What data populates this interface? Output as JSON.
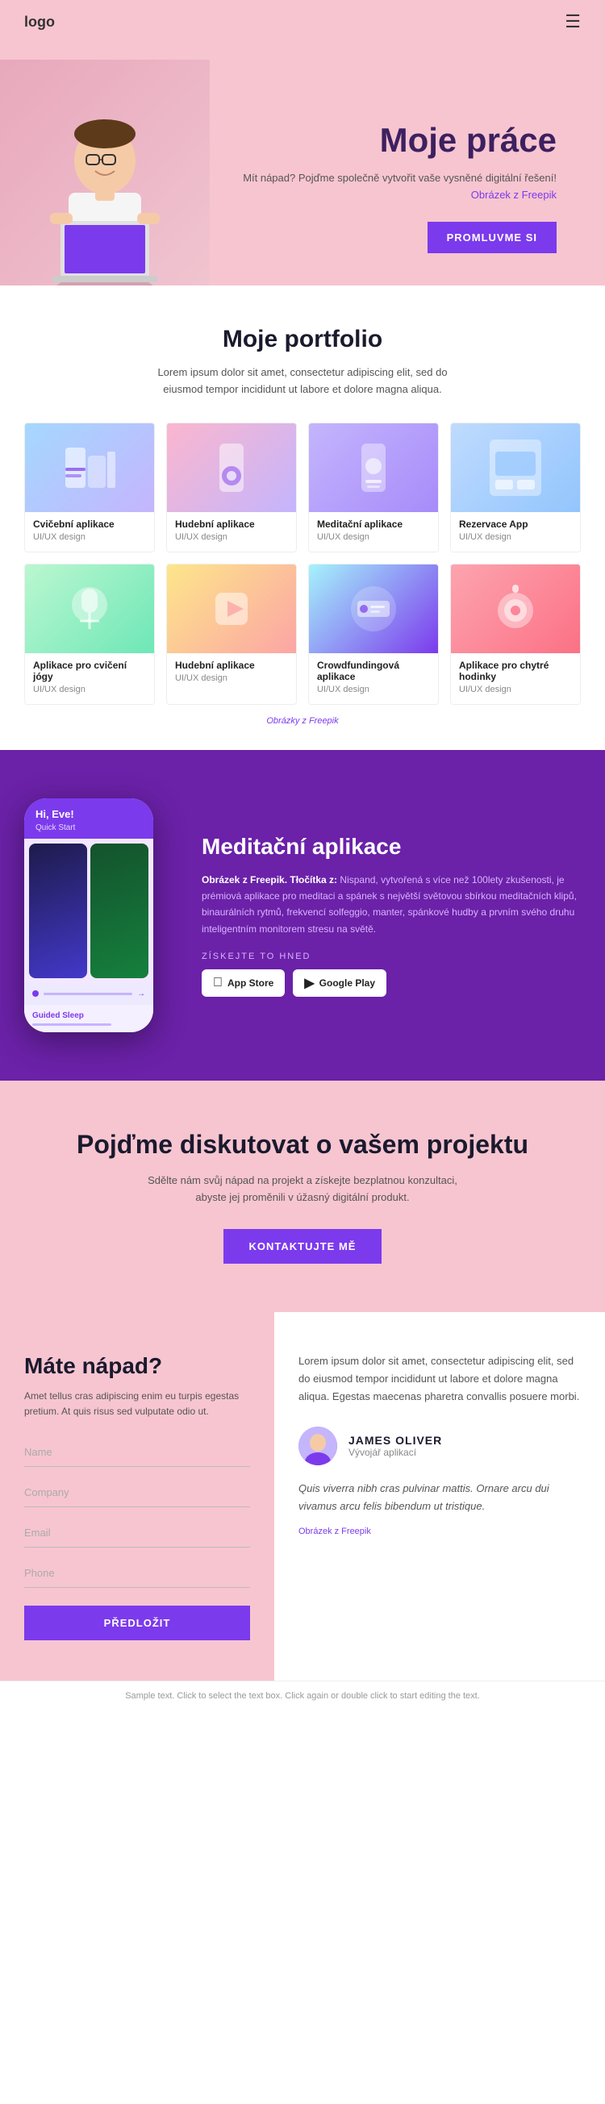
{
  "header": {
    "logo": "logo",
    "hamburger": "☰"
  },
  "hero": {
    "title": "Moje práce",
    "description": "Mít nápad? Pojďme společně vytvořit vaše vysněné digitální řešení!",
    "image_credit": "Obrázek z Freepik",
    "button_label": "PROMLUVME SI"
  },
  "portfolio": {
    "title": "Moje portfolio",
    "description": "Lorem ipsum dolor sit amet, consectetur adipiscing elit, sed do eiusmod tempor incididunt ut labore et dolore magna aliqua.",
    "images_credit": "Obrázky z Freepik",
    "cards": [
      {
        "name": "Cvičební aplikace",
        "type": "UI/UX design",
        "bg": "app1"
      },
      {
        "name": "Hudební aplikace",
        "type": "UI/UX design",
        "bg": "app2"
      },
      {
        "name": "Meditační aplikace",
        "type": "UI/UX design",
        "bg": "app3"
      },
      {
        "name": "Rezervace App",
        "type": "UI/UX design",
        "bg": "app4"
      },
      {
        "name": "Aplikace pro cvičení jógy",
        "type": "UI/UX design",
        "bg": "app5"
      },
      {
        "name": "Hudební aplikace",
        "type": "UI/UX design",
        "bg": "app6"
      },
      {
        "name": "Crowdfundingová aplikace",
        "type": "UI/UX design",
        "bg": "app7"
      },
      {
        "name": "Aplikace pro chytré hodinky",
        "type": "UI/UX design",
        "bg": "app8"
      }
    ]
  },
  "meditation": {
    "phone_greeting": "Hi, Eve!",
    "title": "Meditační aplikace",
    "description_bold": "Obrázek z Freepik. Tłočítka z:",
    "description": "Nispand, vytvořená s více než 100lety zkušenosti, je prémiová aplikace pro meditaci a spánek s největší světovou sbírkou meditačních klipů, binaurálních rytmů, frekvencí solfeggio, manter, spánkové hudby a prvním svého druhu inteligentním monitorem stresu na světě.",
    "get_now_label": "ZÍSKEJTE TO HNED",
    "appstore_label": "App Store",
    "googleplay_label": "Google Play"
  },
  "discuss": {
    "title": "Pojďme diskutovat o vašem projektu",
    "description": "Sdělte nám svůj nápad na projekt a získejte bezplatnou konzultaci, abyste jej proměnili v úžasný digitální produkt.",
    "button_label": "KONTAKTUJTE MĚ"
  },
  "contact": {
    "form": {
      "title": "Máte nápad?",
      "description": "Amet tellus cras adipiscing enim eu turpis egestas pretium. At quis risus sed vulputate odio ut.",
      "name_placeholder": "Name",
      "company_placeholder": "Company",
      "email_placeholder": "Email",
      "phone_placeholder": "Phone",
      "submit_label": "PŘEDLOŽIT"
    },
    "info": {
      "text": "Lorem ipsum dolor sit amet, consectetur adipiscing elit, sed do eiusmod tempor incididunt ut labore et dolore magna aliqua. Egestas maecenas pharetra convallis posuere morbi.",
      "author_name": "JAMES OLIVER",
      "author_role": "Vývojář aplikací",
      "quote": "Quis viverra nibh cras pulvinar mattis. Ornare arcu dui vivamus arcu felis bibendum ut tristique.",
      "credit": "Obrázek z Freepik"
    }
  },
  "footer": {
    "sample_text": "Sample text. Click to select the text box. Click again or double click to start editing the text."
  }
}
